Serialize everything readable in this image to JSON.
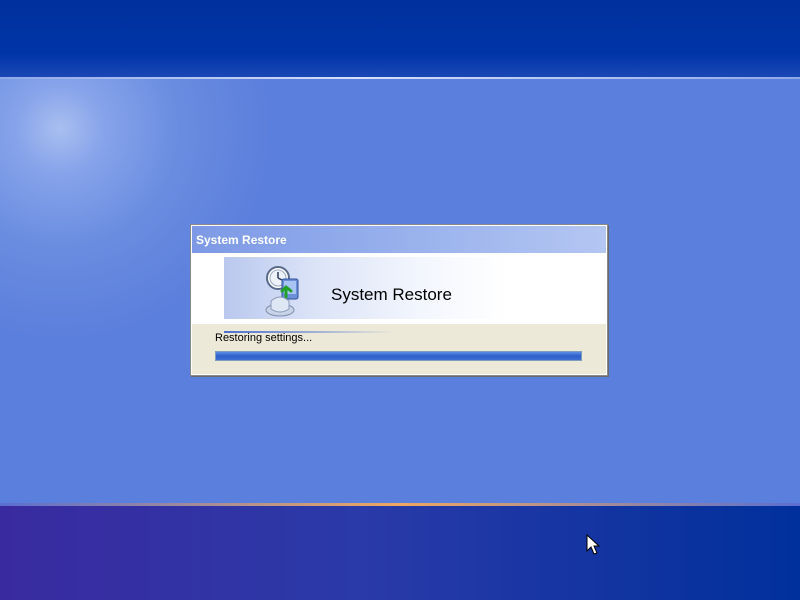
{
  "desktop": {
    "colors": {
      "top_band": "#0035a8",
      "background": "#5b7fdc",
      "bottom_band": "#2a3aa8",
      "accent_line": "#f0a860"
    }
  },
  "dialog": {
    "title": "System Restore",
    "header_title": "System Restore",
    "icon": "system-restore-icon",
    "status": "Restoring settings...",
    "progress": 1.0,
    "colors": {
      "title_bar": "#92aceb",
      "progress": "#2c5fc8",
      "body": "#ece9d8"
    }
  },
  "cursor": {
    "icon": "arrow-cursor-icon"
  }
}
